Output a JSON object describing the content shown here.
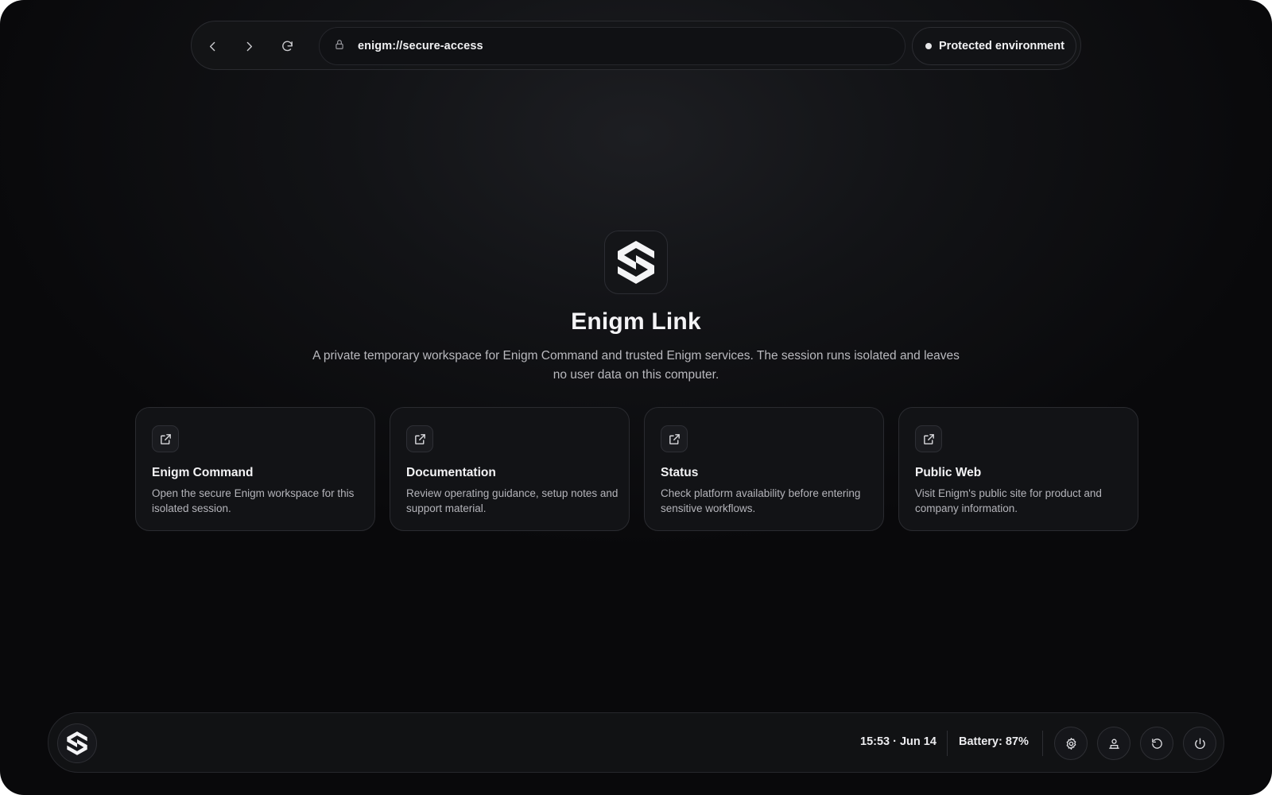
{
  "topbar": {
    "url": "enigm://secure-access",
    "environment_label": "Protected environment",
    "icons": [
      "back-arrow-icon",
      "forward-arrow-icon",
      "reload-icon",
      "lock-icon"
    ]
  },
  "hero": {
    "title": "Enigm Link",
    "subtitle": "A private temporary workspace for Enigm Command and trusted Enigm services. The session runs isolated and leaves no user data on this computer."
  },
  "cards": [
    {
      "title": "Enigm Command",
      "description": "Open the secure Enigm workspace for this isolated session.",
      "icon": "external-link-icon"
    },
    {
      "title": "Documentation",
      "description": "Review operating guidance, setup notes and support material.",
      "icon": "external-link-icon"
    },
    {
      "title": "Status",
      "description": "Check platform availability before entering sensitive workflows.",
      "icon": "external-link-icon"
    },
    {
      "title": "Public Web",
      "description": "Visit Enigm's public site for product and company information.",
      "icon": "external-link-icon"
    }
  ],
  "dock": {
    "clock": "15:53 · Jun 14",
    "battery": "Battery: 87%",
    "buttons": [
      "settings-icon",
      "user-icon",
      "restart-icon",
      "power-icon"
    ]
  },
  "colors": {
    "background": "#09090b",
    "surface": "#121316",
    "border": "#2a2b30",
    "text_primary": "#f3f3f5",
    "text_secondary": "#b4b4ba"
  }
}
